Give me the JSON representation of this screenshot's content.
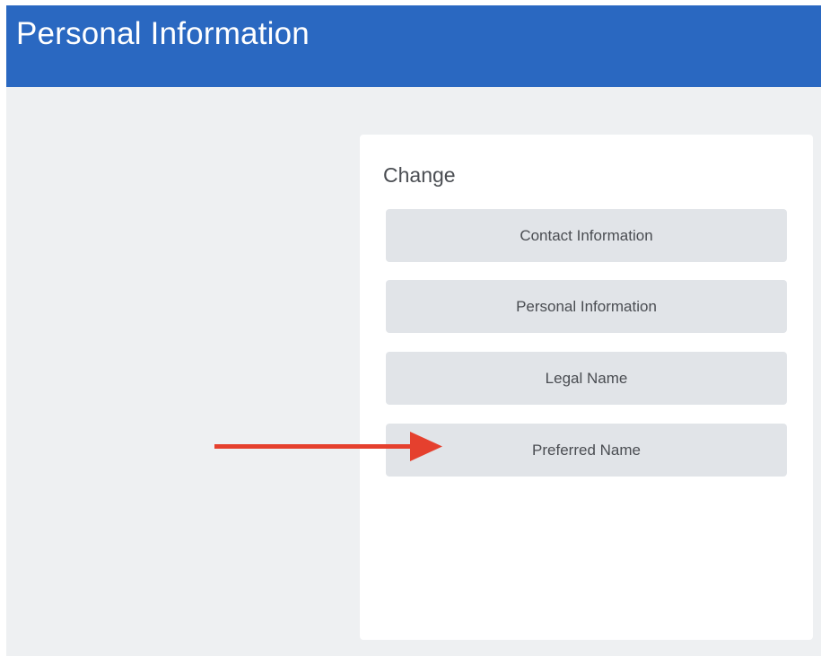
{
  "header": {
    "title": "Personal Information"
  },
  "card": {
    "heading": "Change",
    "buttons": [
      {
        "label": "Contact Information"
      },
      {
        "label": "Personal Information"
      },
      {
        "label": "Legal Name"
      },
      {
        "label": "Preferred Name"
      }
    ]
  },
  "annotation": {
    "arrow_icon": "right-arrow-icon",
    "arrow_color": "#e5402e",
    "points_to": "Preferred Name"
  },
  "colors": {
    "header_bg": "#2a68c1",
    "page_bg": "#eef0f2",
    "button_bg": "#e1e4e8"
  }
}
